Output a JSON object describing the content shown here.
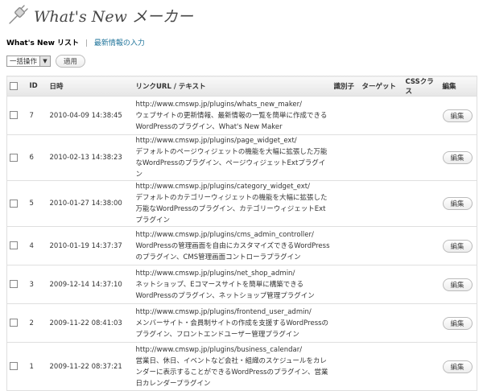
{
  "header": {
    "title": "What's New メーカー",
    "logo_icon": "plug-icon"
  },
  "subnav": {
    "current": "What's New リスト",
    "separator": "|",
    "link": "最新情報の入力"
  },
  "bulk": {
    "selected": "一括操作",
    "apply_label": "適用"
  },
  "columns": {
    "id": "ID",
    "date": "日時",
    "link": "リンクURL / テキスト",
    "identifier": "識別子",
    "target": "ターゲット",
    "css": "CSSクラス",
    "edit": "編集"
  },
  "rows": [
    {
      "id": "7",
      "date": "2010-04-09 14:38:45",
      "url": "http://www.cmswp.jp/plugins/whats_new_maker/",
      "text": "ウェブサイトの更新情報、最新情報の一覧を簡単に作成できるWordPressのプラグイン、What's New Maker",
      "edit": "編集"
    },
    {
      "id": "6",
      "date": "2010-02-13 14:38:23",
      "url": "http://www.cmswp.jp/plugins/page_widget_ext/",
      "text": "デフォルトのページウィジェットの機能を大幅に拡張した万能なWordPressのプラグイン、ページウィジェットExtプラグイン",
      "edit": "編集"
    },
    {
      "id": "5",
      "date": "2010-01-27 14:38:00",
      "url": "http://www.cmswp.jp/plugins/category_widget_ext/",
      "text": "デフォルトのカテゴリーウィジェットの機能を大幅に拡張した万能なWordPressのプラグイン、カテゴリーウィジェットExtプラグイン",
      "edit": "編集"
    },
    {
      "id": "4",
      "date": "2010-01-19 14:37:37",
      "url": "http://www.cmswp.jp/plugins/cms_admin_controller/",
      "text": "WordPressの管理画面を自由にカスタマイズできるWordPressのプラグイン、CMS管理画面コントローラプラグイン",
      "edit": "編集"
    },
    {
      "id": "3",
      "date": "2009-12-14 14:37:10",
      "url": "http://www.cmswp.jp/plugins/net_shop_admin/",
      "text": "ネットショップ、Eコマースサイトを簡単に構築できるWordPressのプラグイン、ネットショップ管理プラグイン",
      "edit": "編集"
    },
    {
      "id": "2",
      "date": "2009-11-22 08:41:03",
      "url": "http://www.cmswp.jp/plugins/frontend_user_admin/",
      "text": "メンバーサイト・会員制サイトの作成を支援するWordPressのプラグイン、フロントエンドユーザー管理プラグイン",
      "edit": "編集"
    },
    {
      "id": "1",
      "date": "2009-11-22 08:37:21",
      "url": "http://www.cmswp.jp/plugins/business_calendar/",
      "text": "営業日、休日、イベントなど会社・組織のスケジュールをカレンダーに表示することができるWordPressのプラグイン、営業日カレンダープラグイン",
      "edit": "編集"
    }
  ]
}
